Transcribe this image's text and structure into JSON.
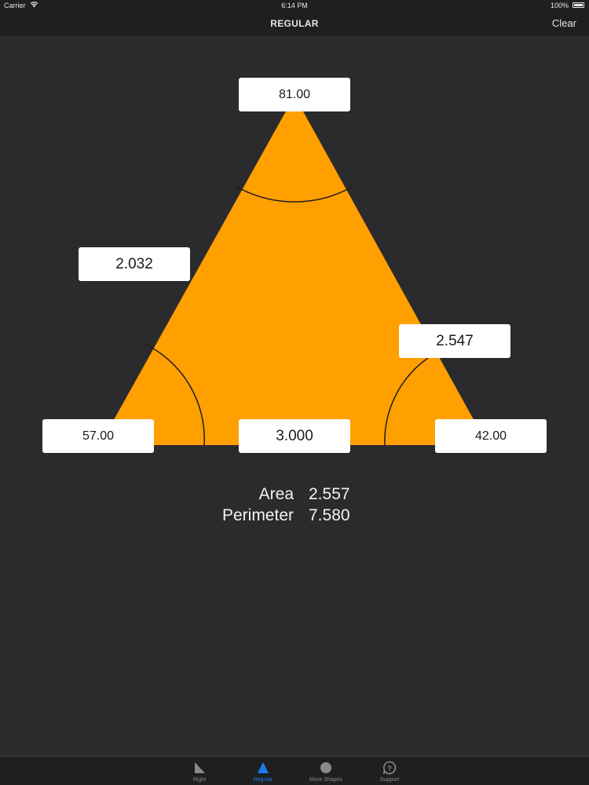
{
  "status_bar": {
    "carrier": "Carrier",
    "time": "6:14 PM",
    "battery": "100%"
  },
  "nav": {
    "title": "REGULAR",
    "clear_label": "Clear"
  },
  "triangle": {
    "fill_color": "#ff9f00",
    "angle_top": "81.00",
    "angle_left": "57.00",
    "angle_right": "42.00",
    "side_left": "2.032",
    "side_right": "2.547",
    "side_bottom": "3.000"
  },
  "results": {
    "area_label": "Area",
    "area_value": "2.557",
    "perimeter_label": "Perimeter",
    "perimeter_value": "7.580"
  },
  "tabs": [
    {
      "label": "Right",
      "icon": "right-triangle-icon",
      "active": false
    },
    {
      "label": "Regular",
      "icon": "triangle-icon",
      "active": true
    },
    {
      "label": "More Shapes",
      "icon": "circle-icon",
      "active": false
    },
    {
      "label": "Support",
      "icon": "support-icon",
      "active": false
    }
  ],
  "colors": {
    "background": "#2b2b2d",
    "bar": "#1f1f21",
    "accent": "#1a7bf2",
    "shape": "#ff9f00"
  }
}
